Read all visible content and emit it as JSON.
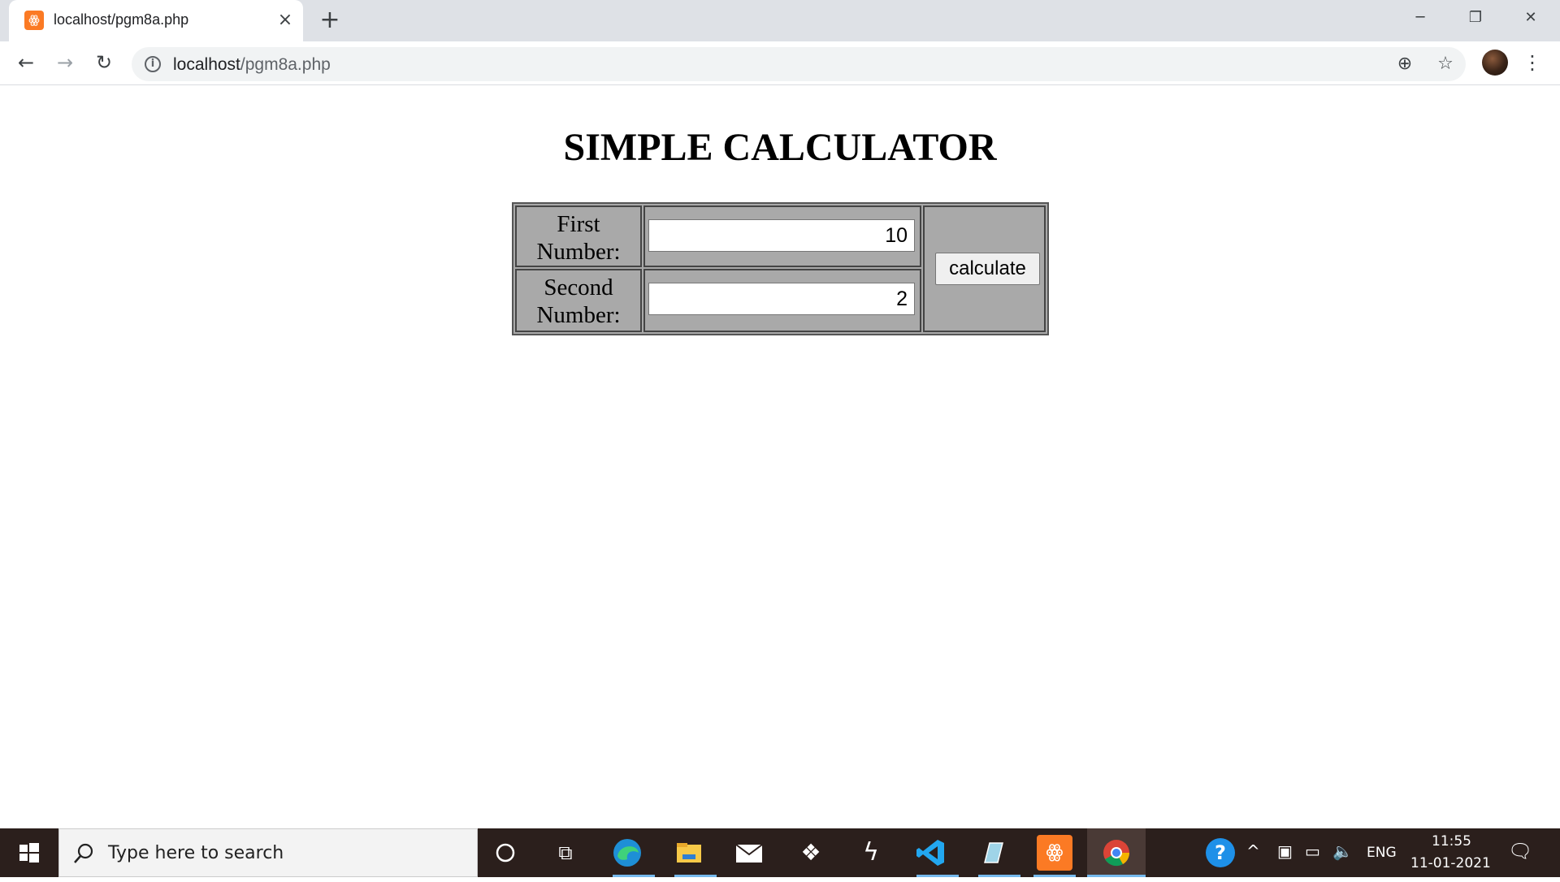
{
  "browser": {
    "tab_title": "localhost/pgm8a.php",
    "url_host": "localhost",
    "url_path": "/pgm8a.php"
  },
  "page": {
    "title": "SIMPLE CALCULATOR",
    "first_label_line1": "First",
    "first_label_line2": "Number:",
    "first_value": "10",
    "second_label_line1": "Second",
    "second_label_line2": "Number:",
    "second_value": "2",
    "button_label": "calculate"
  },
  "taskbar": {
    "search_placeholder": "Type here to search",
    "language": "ENG",
    "time": "11:55",
    "date": "11-01-2021"
  },
  "icons": {
    "xampp": "xampp-icon",
    "chrome": "chrome-icon",
    "vscode": "vscode-icon",
    "edge": "edge-icon"
  },
  "colors": {
    "table_bg": "#a9a9a9",
    "taskbar_bg": "#2b1f1c",
    "xampp_orange": "#fb7a24",
    "chrome_frame": "#dee1e6"
  }
}
